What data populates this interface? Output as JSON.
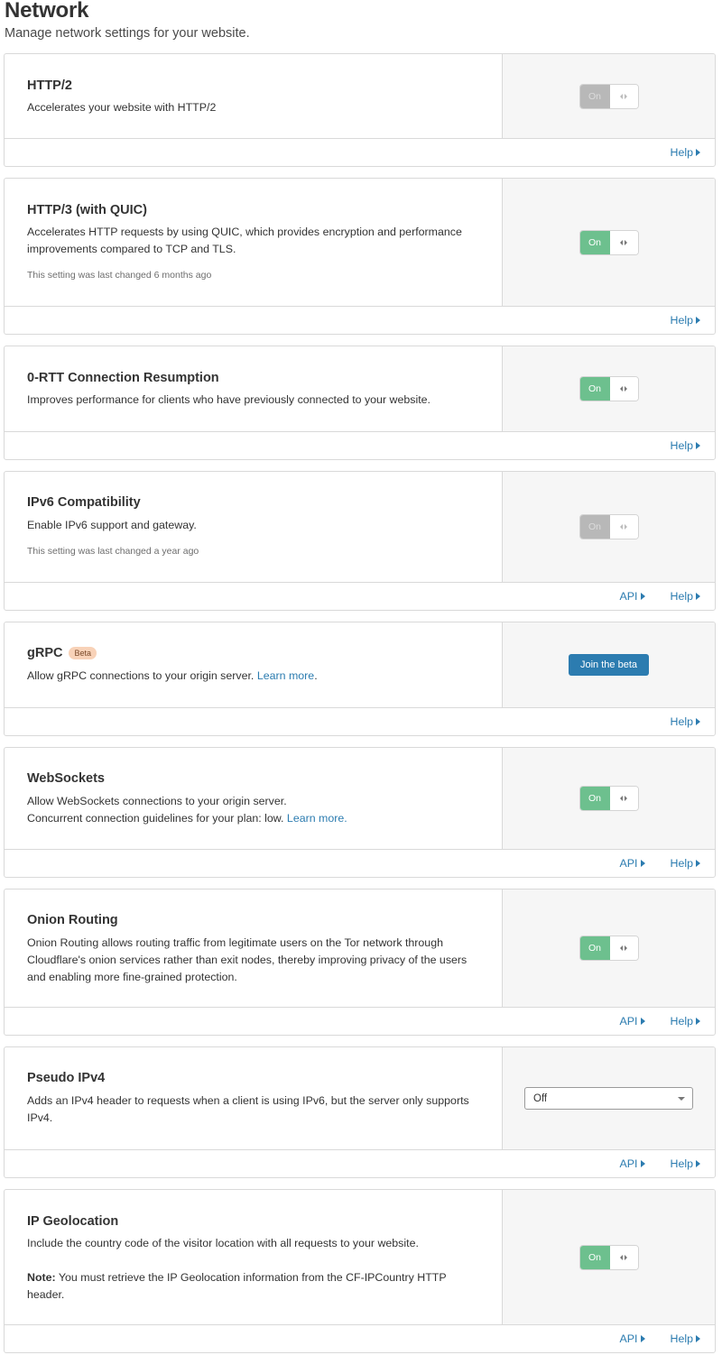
{
  "header": {
    "title": "Network",
    "subtitle": "Manage network settings for your website."
  },
  "colors": {
    "toggle_on": "#6dc08e",
    "toggle_disabled": "#b8b8b8",
    "link": "#2c7cb0",
    "primary_button": "#2c7cb0",
    "beta_badge": "#f8d2b8"
  },
  "settings": [
    {
      "title": "HTTP/2",
      "description": "Accelerates your website with HTTP/2",
      "control": "toggle",
      "toggle_label": "On",
      "toggle_state": "on-disabled",
      "footer": {
        "help": "Help"
      }
    },
    {
      "title": "HTTP/3 (with QUIC)",
      "description": "Accelerates HTTP requests by using QUIC, which provides encryption and performance improvements compared to TCP and TLS.",
      "meta": "This setting was last changed 6 months ago",
      "control": "toggle",
      "toggle_label": "On",
      "toggle_state": "on",
      "footer": {
        "help": "Help"
      }
    },
    {
      "title": "0-RTT Connection Resumption",
      "description": "Improves performance for clients who have previously connected to your website.",
      "control": "toggle",
      "toggle_label": "On",
      "toggle_state": "on",
      "footer": {
        "help": "Help"
      }
    },
    {
      "title": "IPv6 Compatibility",
      "description": "Enable IPv6 support and gateway.",
      "meta": "This setting was last changed a year ago",
      "control": "toggle",
      "toggle_label": "On",
      "toggle_state": "on-disabled",
      "footer": {
        "api": "API",
        "help": "Help"
      }
    },
    {
      "title": "gRPC",
      "badge": "Beta",
      "description": "Allow gRPC connections to your origin server.",
      "link_text": "Learn more",
      "link_suffix": ".",
      "control": "button",
      "button_label": "Join the beta",
      "footer": {
        "help": "Help"
      }
    },
    {
      "title": "WebSockets",
      "description": "Allow WebSockets connections to your origin server.",
      "description_line2": "Concurrent connection guidelines for your plan: low.",
      "link_text": "Learn more.",
      "control": "toggle",
      "toggle_label": "On",
      "toggle_state": "on",
      "footer": {
        "api": "API",
        "help": "Help"
      }
    },
    {
      "title": "Onion Routing",
      "description": "Onion Routing allows routing traffic from legitimate users on the Tor network through Cloudflare's onion services rather than exit nodes, thereby improving privacy of the users and enabling more fine-grained protection.",
      "control": "toggle",
      "toggle_label": "On",
      "toggle_state": "on",
      "footer": {
        "api": "API",
        "help": "Help"
      }
    },
    {
      "title": "Pseudo IPv4",
      "description": "Adds an IPv4 header to requests when a client is using IPv6, but the server only supports IPv4.",
      "control": "select",
      "select_value": "Off",
      "footer": {
        "api": "API",
        "help": "Help"
      }
    },
    {
      "title": "IP Geolocation",
      "description": "Include the country code of the visitor location with all requests to your website.",
      "note_label": "Note:",
      "note_text": " You must retrieve the IP Geolocation information from the CF-IPCountry HTTP header.",
      "control": "toggle",
      "toggle_label": "On",
      "toggle_state": "on",
      "footer": {
        "api": "API",
        "help": "Help"
      }
    }
  ]
}
